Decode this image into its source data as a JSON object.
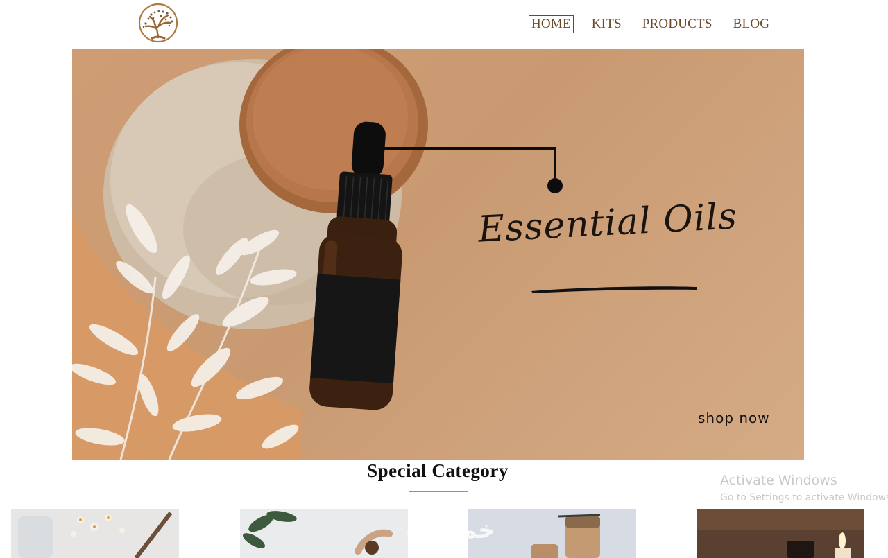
{
  "header": {
    "logo_icon": "tree-logo-icon",
    "nav": [
      {
        "label": "HOME",
        "active": true
      },
      {
        "label": "KITS",
        "active": false
      },
      {
        "label": "PRODUCTS",
        "active": false
      },
      {
        "label": "BLOG",
        "active": false
      }
    ]
  },
  "hero": {
    "title": "Essential Oils",
    "cta": "shop now"
  },
  "special_category": {
    "title": "Special Category",
    "cards": [
      {
        "name": "flowers-jars"
      },
      {
        "name": "green-plant-bottle"
      },
      {
        "name": "cork-jars"
      },
      {
        "name": "candle-bottle"
      }
    ]
  },
  "os_watermark": {
    "title": "Activate Windows",
    "subtitle": "Go to Settings to activate Windows."
  },
  "site_watermark": "خمسات",
  "colors": {
    "brand_brown": "#6b4a2a",
    "hero_bg": "#cf9d74",
    "accent_gold": "#b88a5a"
  }
}
